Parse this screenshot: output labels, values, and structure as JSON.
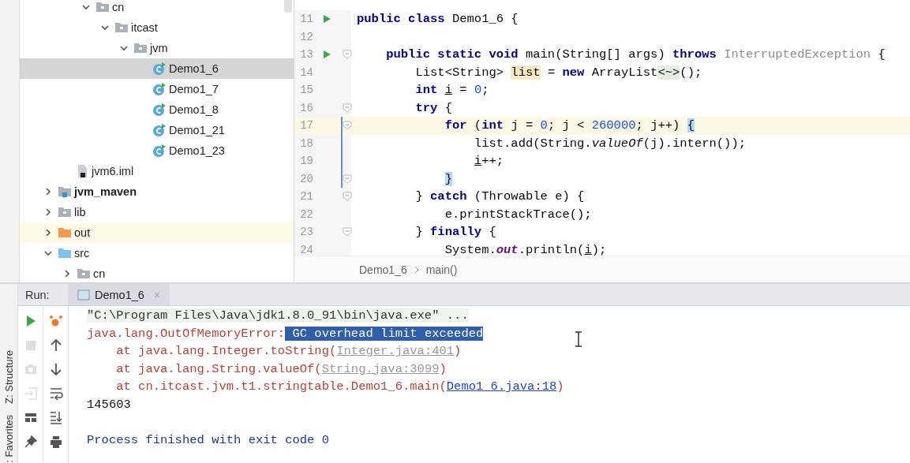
{
  "side_strip": {
    "tools": [
      {
        "label": "Z: Structure"
      },
      {
        "label": ": Favorites"
      }
    ]
  },
  "project_tree": {
    "items": [
      {
        "children": [
          {
            "children": [
              {
                "label": "cn",
                "kind": "folder",
                "expanded": true,
                "selected": false,
                "children": [
                  {
                    "label": "itcast",
                    "kind": "folder",
                    "expanded": true,
                    "selected": false,
                    "children": [
                      {
                        "label": "jvm",
                        "kind": "folder",
                        "expanded": true,
                        "selected": false,
                        "children": [
                          {
                            "label": "Demo1_6",
                            "kind": "class",
                            "selected": true
                          },
                          {
                            "label": "Demo1_7",
                            "kind": "class",
                            "selected": false
                          },
                          {
                            "label": "Demo1_8",
                            "kind": "class",
                            "selected": false
                          },
                          {
                            "label": "Demo1_21",
                            "kind": "class",
                            "selected": false
                          },
                          {
                            "label": "Demo1_23",
                            "kind": "class",
                            "selected": false
                          }
                        ]
                      }
                    ]
                  }
                ]
              }
            ]
          },
          {
            "label": "jvm6.iml",
            "kind": "iml",
            "selected": false
          }
        ]
      },
      {
        "label": "jvm_maven",
        "kind": "module",
        "expanded": false,
        "selected": false
      },
      {
        "label": "lib",
        "kind": "folder",
        "expanded": false,
        "selected": false
      },
      {
        "label": "out",
        "kind": "excluded",
        "expanded": false,
        "selected": false
      },
      {
        "label": "src",
        "kind": "source",
        "expanded": true,
        "selected": false,
        "children": [
          {
            "label": "cn",
            "kind": "folder",
            "expanded": false,
            "selected": false
          }
        ]
      }
    ]
  },
  "editor": {
    "lines": [
      {
        "number": "11",
        "run_marker": true,
        "fold": false,
        "current": false,
        "modified": false,
        "tokens": [
          {
            "text": "public class",
            "kind": "kw"
          },
          {
            "text": " Demo1_6 {",
            "kind": "plain"
          }
        ]
      },
      {
        "number": "12",
        "run_marker": false,
        "fold": false,
        "current": false,
        "modified": false
      },
      {
        "number": "13",
        "run_marker": true,
        "fold": true,
        "current": false,
        "modified": false,
        "tokens": [
          {
            "text": "    public static void",
            "kind": "kw"
          },
          {
            "text": " main(String[] args) ",
            "kind": "plain"
          },
          {
            "text": "throws",
            "kind": "kw"
          },
          {
            "text": " InterruptedException",
            "kind": "unused"
          },
          {
            "text": " {",
            "kind": "plain"
          }
        ]
      },
      {
        "number": "14",
        "run_marker": false,
        "fold": false,
        "current": false,
        "modified": false,
        "tokens": [
          {
            "text": "        List<String> ",
            "kind": "plain"
          },
          {
            "text": "list",
            "kind": "usage"
          },
          {
            "text": " = ",
            "kind": "plain"
          },
          {
            "text": "new",
            "kind": "kw"
          },
          {
            "text": " ArrayList",
            "kind": "plain"
          },
          {
            "text": "<~>",
            "kind": "diamond"
          },
          {
            "text": "();",
            "kind": "plain"
          }
        ]
      },
      {
        "number": "15",
        "run_marker": false,
        "fold": false,
        "current": false,
        "modified": false,
        "tokens": [
          {
            "text": "        int",
            "kind": "kw"
          },
          {
            "text": " i",
            "kind": "var"
          },
          {
            "text": " = ",
            "kind": "plain"
          },
          {
            "text": "0",
            "kind": "num"
          },
          {
            "text": ";",
            "kind": "plain"
          }
        ]
      },
      {
        "number": "16",
        "run_marker": false,
        "fold": true,
        "current": false,
        "modified": false,
        "tokens": [
          {
            "text": "        try",
            "kind": "kw"
          },
          {
            "text": " {",
            "kind": "plain"
          }
        ]
      },
      {
        "number": "17",
        "run_marker": false,
        "fold": true,
        "current": true,
        "modified": true,
        "tokens": [
          {
            "text": "            for",
            "kind": "kw"
          },
          {
            "text": " (",
            "kind": "plain"
          },
          {
            "text": "int",
            "kind": "kw"
          },
          {
            "text": " j = ",
            "kind": "plain"
          },
          {
            "text": "0",
            "kind": "num"
          },
          {
            "text": "; j < ",
            "kind": "plain"
          },
          {
            "text": "260000",
            "kind": "num"
          },
          {
            "text": "; j++) ",
            "kind": "plain"
          },
          {
            "text": "{",
            "kind": "brace"
          }
        ]
      },
      {
        "number": "18",
        "run_marker": false,
        "fold": false,
        "current": false,
        "modified": true,
        "tokens": [
          {
            "text": "                list.add(String.",
            "kind": "plain"
          },
          {
            "text": "valueOf",
            "kind": "static"
          },
          {
            "text": "(j).intern());",
            "kind": "plain"
          }
        ]
      },
      {
        "number": "19",
        "run_marker": false,
        "fold": false,
        "current": false,
        "modified": true,
        "tokens": [
          {
            "text": "                i",
            "kind": "var"
          },
          {
            "text": "++;",
            "kind": "plain"
          }
        ]
      },
      {
        "number": "20",
        "run_marker": false,
        "fold": true,
        "current": false,
        "modified": true,
        "tokens": [
          {
            "text": "            }",
            "kind": "brace"
          }
        ]
      },
      {
        "number": "21",
        "run_marker": false,
        "fold": true,
        "current": false,
        "modified": false,
        "tokens": [
          {
            "text": "        } ",
            "kind": "plain"
          },
          {
            "text": "catch",
            "kind": "kw"
          },
          {
            "text": " (Throwable e) {",
            "kind": "plain"
          }
        ]
      },
      {
        "number": "22",
        "run_marker": false,
        "fold": false,
        "current": false,
        "modified": false,
        "tokens": [
          {
            "text": "            e.printStackTrace();",
            "kind": "plain"
          }
        ]
      },
      {
        "number": "23",
        "run_marker": false,
        "fold": true,
        "current": false,
        "modified": false,
        "tokens": [
          {
            "text": "        } ",
            "kind": "plain"
          },
          {
            "text": "finally",
            "kind": "kw"
          },
          {
            "text": " {",
            "kind": "plain"
          }
        ]
      },
      {
        "number": "24",
        "run_marker": false,
        "fold": false,
        "current": false,
        "modified": false,
        "tokens": [
          {
            "text": "            System.",
            "kind": "plain"
          },
          {
            "text": "out",
            "kind": "field"
          },
          {
            "text": ".println(",
            "kind": "plain"
          },
          {
            "text": "i",
            "kind": "var"
          },
          {
            "text": ");",
            "kind": "plain"
          }
        ]
      }
    ],
    "breadcrumb": [
      "Demo1_6",
      "main()"
    ]
  },
  "run_panel": {
    "title": "Run:",
    "tab": {
      "label": "Demo1_6",
      "close": "×"
    },
    "toolbar_left": [
      {
        "kind": "rerun",
        "disabled": false
      },
      {
        "kind": "stop",
        "disabled": true
      },
      {
        "kind": "camera",
        "disabled": true
      },
      {
        "kind": "import",
        "disabled": true
      },
      {
        "kind": "layout",
        "disabled": false
      },
      {
        "kind": "pin",
        "disabled": false
      }
    ],
    "toolbar_right": [
      {
        "kind": "bug",
        "disabled": false
      },
      {
        "kind": "up",
        "disabled": false
      },
      {
        "kind": "down",
        "disabled": false
      },
      {
        "kind": "wrap",
        "disabled": false
      },
      {
        "kind": "scroll-end",
        "disabled": false
      },
      {
        "kind": "print",
        "disabled": false
      }
    ],
    "console": [
      {
        "segments": [
          {
            "text": "\"C:\\Program Files\\Java\\jdk1.8.0_91\\bin\\java.exe\" ...",
            "kind": "cmd"
          }
        ]
      },
      {
        "segments": [
          {
            "text": "java.lang.OutOfMemoryError:",
            "kind": "error"
          },
          {
            "text": " GC overhead limit exceeded",
            "kind": "selected"
          }
        ]
      },
      {
        "segments": [
          {
            "text": "    at java.lang.Integer.toString(",
            "kind": "error"
          },
          {
            "text": "Integer.java:401",
            "kind": "lib-link"
          },
          {
            "text": ")",
            "kind": "error"
          }
        ]
      },
      {
        "segments": [
          {
            "text": "    at java.lang.String.valueOf(",
            "kind": "error"
          },
          {
            "text": "String.java:3099",
            "kind": "lib-link"
          },
          {
            "text": ")",
            "kind": "error"
          }
        ]
      },
      {
        "segments": [
          {
            "text": "    at cn.itcast.jvm.t1.stringtable.Demo1_6.main(",
            "kind": "error"
          },
          {
            "text": "Demo1_6.java:18",
            "kind": "link"
          },
          {
            "text": ")",
            "kind": "error"
          }
        ]
      },
      {
        "segments": [
          {
            "text": "145603",
            "kind": "output"
          }
        ]
      },
      {
        "segments": [
          {
            "text": "Process finished with exit code 0",
            "kind": "info"
          }
        ]
      }
    ]
  }
}
